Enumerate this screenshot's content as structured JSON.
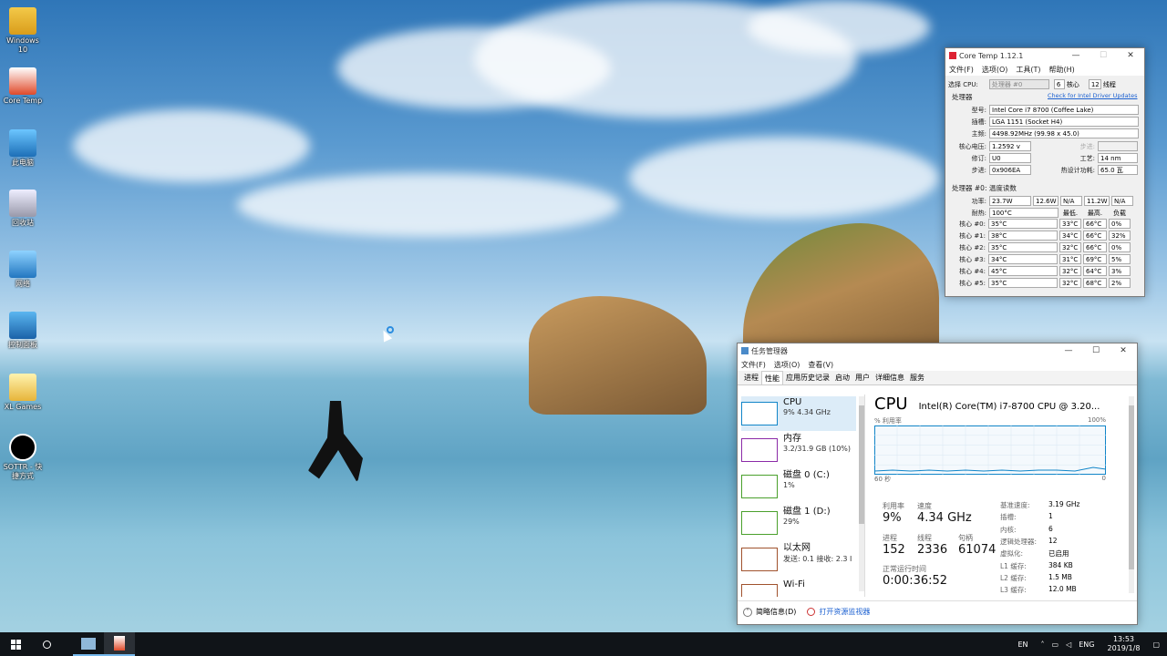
{
  "desktop": {
    "icons": [
      {
        "label": "Windows 10",
        "icon": "folder-user-icon"
      },
      {
        "label": "Core Temp",
        "icon": "thermometer-icon"
      },
      {
        "label": "此电脑",
        "icon": "computer-icon"
      },
      {
        "label": "回收站",
        "icon": "recycle-bin-icon"
      },
      {
        "label": "网络",
        "icon": "network-icon"
      },
      {
        "label": "控制面板",
        "icon": "control-panel-icon"
      },
      {
        "label": "XL Games",
        "icon": "folder-icon"
      },
      {
        "label": "SOTTR - 快捷方式",
        "icon": "game-shortcut-icon"
      }
    ]
  },
  "coretemp": {
    "title": "Core Temp 1.12.1",
    "menu": [
      "文件(F)",
      "选项(O)",
      "工具(T)",
      "帮助(H)"
    ],
    "select_cpu_label": "选择 CPU:",
    "cpu_select": "处理器 #0",
    "cores": "6",
    "cores_label": "核心",
    "threads": "12",
    "threads_label": "线程",
    "processor_label": "处理器",
    "driver_link": "Check for Intel Driver Updates",
    "info": [
      {
        "k": "型号:",
        "v": "Intel Core i7 8700 (Coffee Lake)"
      },
      {
        "k": "插槽:",
        "v": "LGA 1151 (Socket H4)"
      },
      {
        "k": "主频:",
        "v": "4498.92MHz (99.98 x 45.0)"
      }
    ],
    "vid_label": "核心电压:",
    "vid": "1.2592 v",
    "step_label": "步进:",
    "step": "",
    "rev_label": "修订:",
    "rev": "U0",
    "lith_label": "工艺:",
    "lith": "14 nm",
    "cpuid_label": "步进:",
    "cpuid": "0x906EA",
    "tdp_label": "热设计功耗:",
    "tdp": "65.0 瓦",
    "temp_group": "处理器 #0: 温度读数",
    "power_label": "功率:",
    "power": [
      "23.7W",
      "12.6W",
      "N/A",
      "11.2W",
      "N/A"
    ],
    "tj_label": "耐热:",
    "tj": "100°C",
    "col_min": "最低.",
    "col_max": "最高.",
    "col_load": "负载",
    "cores_rows": [
      {
        "k": "核心 #0:",
        "t": "35°C",
        "min": "33°C",
        "max": "66°C",
        "load": "0%"
      },
      {
        "k": "核心 #1:",
        "t": "38°C",
        "min": "34°C",
        "max": "66°C",
        "load": "32%"
      },
      {
        "k": "核心 #2:",
        "t": "35°C",
        "min": "32°C",
        "max": "66°C",
        "load": "0%"
      },
      {
        "k": "核心 #3:",
        "t": "34°C",
        "min": "31°C",
        "max": "69°C",
        "load": "5%"
      },
      {
        "k": "核心 #4:",
        "t": "45°C",
        "min": "32°C",
        "max": "64°C",
        "load": "3%"
      },
      {
        "k": "核心 #5:",
        "t": "35°C",
        "min": "32°C",
        "max": "68°C",
        "load": "2%"
      }
    ]
  },
  "taskmgr": {
    "title": "任务管理器",
    "menu": [
      "文件(F)",
      "选项(O)",
      "查看(V)"
    ],
    "tabs": [
      "进程",
      "性能",
      "应用历史记录",
      "启动",
      "用户",
      "详细信息",
      "服务"
    ],
    "side": [
      {
        "n": "CPU",
        "s": "9% 4.34 GHz",
        "color": "#1185c8"
      },
      {
        "n": "内存",
        "s": "3.2/31.9 GB (10%)",
        "color": "#8b2aa7"
      },
      {
        "n": "磁盘 0 (C:)",
        "s": "1%",
        "color": "#4aa02c"
      },
      {
        "n": "磁盘 1 (D:)",
        "s": "29%",
        "color": "#4aa02c"
      },
      {
        "n": "以太网",
        "s": "发送: 0.1  接收: 2.3 I",
        "color": "#a0522d"
      },
      {
        "n": "Wi-Fi",
        "s": "",
        "color": "#a0522d"
      }
    ],
    "cpu_title": "CPU",
    "cpu_model": "Intel(R) Core(TM) i7-8700 CPU @ 3.20...",
    "graph_label_left": "% 利用率",
    "graph_label_right": "100%",
    "graph_bottom_left": "60 秒",
    "graph_bottom_right": "0",
    "util_label": "利用率",
    "util": "9%",
    "speed_label": "速度",
    "speed": "4.34 GHz",
    "proc_label": "进程",
    "proc": "152",
    "thr_label": "线程",
    "thr": "2336",
    "hnd_label": "句柄",
    "hnd": "61074",
    "uptime_label": "正常运行时间",
    "uptime": "0:00:36:52",
    "details": [
      {
        "k": "基准速度:",
        "v": "3.19 GHz"
      },
      {
        "k": "插槽:",
        "v": "1"
      },
      {
        "k": "内核:",
        "v": "6"
      },
      {
        "k": "逻辑处理器:",
        "v": "12"
      },
      {
        "k": "虚拟化:",
        "v": "已启用"
      },
      {
        "k": "L1 缓存:",
        "v": "384 KB"
      },
      {
        "k": "L2 缓存:",
        "v": "1.5 MB"
      },
      {
        "k": "L3 缓存:",
        "v": "12.0 MB"
      }
    ],
    "fewer_details": "简略信息(D)",
    "open_monitor": "打开资源监视器"
  },
  "taskbar": {
    "lang": "EN",
    "ime": "ENG",
    "time": "13:53",
    "date": "2019/1/8"
  }
}
